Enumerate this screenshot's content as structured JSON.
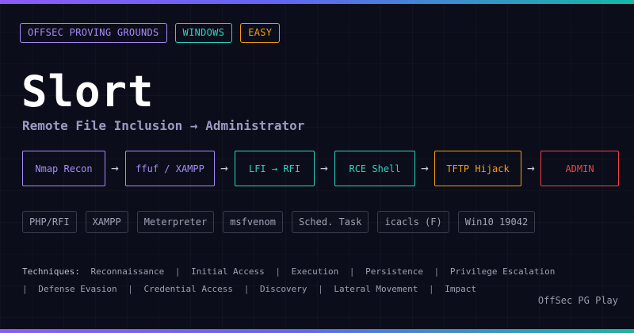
{
  "tags": [
    {
      "label": "OFFSEC PROVING GROUNDS",
      "color": "#a78bfa"
    },
    {
      "label": "WINDOWS",
      "color": "#2dd4bf"
    },
    {
      "label": "EASY",
      "color": "#f59e0b"
    }
  ],
  "title": "Slort",
  "subtitle": "Remote File Inclusion → Administrator",
  "chain": {
    "arrow": "→",
    "steps": [
      {
        "label": "Nmap Recon",
        "color": "#a78bfa"
      },
      {
        "label": "ffuf / XAMPP",
        "color": "#a78bfa"
      },
      {
        "label": "LFI → RFI",
        "color": "#2dd4bf"
      },
      {
        "label": "RCE Shell",
        "color": "#2dd4bf"
      },
      {
        "label": "TFTP Hijack",
        "color": "#f59e0b"
      },
      {
        "label": "ADMIN",
        "color": "#ef4444"
      }
    ]
  },
  "tools": [
    "PHP/RFI",
    "XAMPP",
    "Meterpreter",
    "msfvenom",
    "Sched. Task",
    "icacls (F)",
    "Win10 19042"
  ],
  "techniques": {
    "label": "Techniques:",
    "separator": "|",
    "line1": [
      "Reconnaissance",
      "Initial Access",
      "Execution",
      "Persistence",
      "Privilege Escalation"
    ],
    "line2": [
      "Defense Evasion",
      "Credential Access",
      "Discovery",
      "Lateral Movement",
      "Impact"
    ]
  },
  "brand": "OffSec PG Play"
}
